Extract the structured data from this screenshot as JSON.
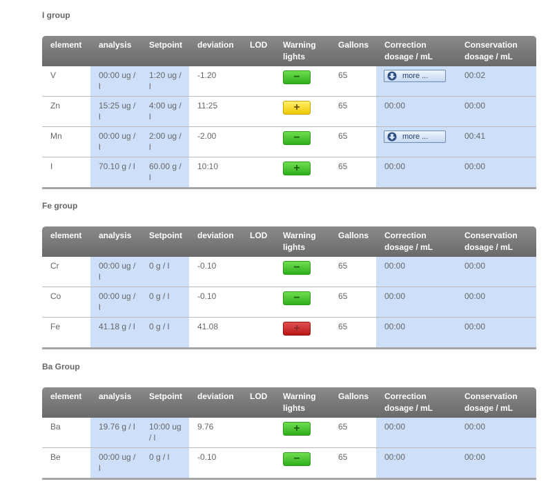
{
  "columns": [
    "element",
    "analysis",
    "Setpoint",
    "deviation",
    "LOD",
    "Warning lights",
    "Gallons",
    "Correction dosage / mL",
    "Conservation dosage / mL"
  ],
  "groups": [
    {
      "title": "I group",
      "rows": [
        {
          "element": "V",
          "analysis": "00:00 ug / l",
          "setpoint": "1:20 ug / l",
          "deviation": "-1.20",
          "lod": "",
          "warning": "green",
          "warning_symbol": "−",
          "gallons": "65",
          "correction": "more ...",
          "correction_is_button": true,
          "conservation": "00:02"
        },
        {
          "element": "Zn",
          "analysis": "15:25 ug / l",
          "setpoint": "4:00 ug / l",
          "deviation": "11:25",
          "lod": "",
          "warning": "yellow",
          "warning_symbol": "+",
          "gallons": "65",
          "correction": "00:00",
          "correction_is_button": false,
          "conservation": "00:00"
        },
        {
          "element": "Mn",
          "analysis": "00:00 ug / l",
          "setpoint": "2:00 ug / l",
          "deviation": "-2.00",
          "lod": "",
          "warning": "green",
          "warning_symbol": "−",
          "gallons": "65",
          "correction": "more ...",
          "correction_is_button": true,
          "conservation": "00:41"
        },
        {
          "element": "I",
          "analysis": "70.10 g / l",
          "setpoint": "60.00 g / l",
          "deviation": "10:10",
          "lod": "",
          "warning": "green",
          "warning_symbol": "+",
          "gallons": "65",
          "correction": "00:00",
          "correction_is_button": false,
          "conservation": "00:00"
        }
      ]
    },
    {
      "title": "Fe group",
      "rows": [
        {
          "element": "Cr",
          "analysis": "00:00 ug / l",
          "setpoint": "0 g / l",
          "deviation": "-0.10",
          "lod": "",
          "warning": "green",
          "warning_symbol": "−",
          "gallons": "65",
          "correction": "00:00",
          "correction_is_button": false,
          "conservation": "00:00"
        },
        {
          "element": "Co",
          "analysis": "00:00 ug / l",
          "setpoint": "0 g / l",
          "deviation": "-0.10",
          "lod": "",
          "warning": "green",
          "warning_symbol": "−",
          "gallons": "65",
          "correction": "00:00",
          "correction_is_button": false,
          "conservation": "00:00"
        },
        {
          "element": "Fe",
          "analysis": "41.18 g / l",
          "setpoint": "0 g / l",
          "deviation": "41.08",
          "lod": "",
          "warning": "red",
          "warning_symbol": "+",
          "gallons": "65",
          "correction": "00:00",
          "correction_is_button": false,
          "conservation": "00:00"
        }
      ]
    },
    {
      "title": "Ba Group",
      "rows": [
        {
          "element": "Ba",
          "analysis": "19.76 g / l",
          "setpoint": "10:00 ug / l",
          "deviation": "9.76",
          "lod": "",
          "warning": "green",
          "warning_symbol": "+",
          "gallons": "65",
          "correction": "00:00",
          "correction_is_button": false,
          "conservation": "00:00"
        },
        {
          "element": "Be",
          "analysis": "00:00 ug / l",
          "setpoint": "0 g / l",
          "deviation": "-0.10",
          "lod": "",
          "warning": "green",
          "warning_symbol": "−",
          "gallons": "65",
          "correction": "00:00",
          "correction_is_button": false,
          "conservation": "00:00"
        }
      ]
    }
  ],
  "colors": {
    "header_bg": "#767676",
    "highlight_col": "#cddff9",
    "green": "#3fbf28",
    "yellow": "#f5d400",
    "red": "#c62020"
  },
  "icons": {
    "more_button_icon": "download-arrow-icon"
  }
}
